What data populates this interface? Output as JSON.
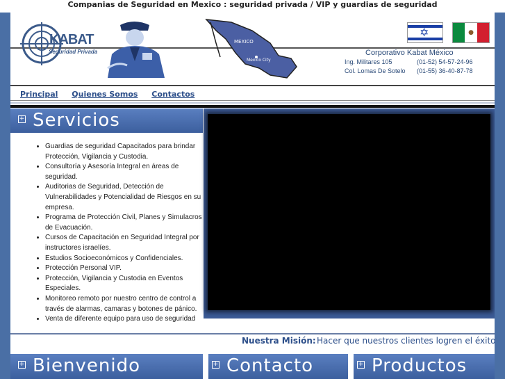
{
  "top_title": "Companias de Seguridad en Mexico : seguridad privada / VIP y guardias de seguridad",
  "logo": {
    "brand": "KABAT",
    "tagline": "Seguridad Privada"
  },
  "map": {
    "country_label": "MEXICO",
    "city_label": "Mexico City"
  },
  "corporate": {
    "name": "Corporativo Kabat México",
    "address1": "Ing. Militares 105",
    "phone1": "(01-52) 54-57-24-96",
    "address2": "Col. Lomas De Sotelo",
    "phone2": "(01-55) 36-40-87-78"
  },
  "nav": [
    "Principal",
    "Quienes Somos",
    "Contactos"
  ],
  "servicios": {
    "title": "Servicios",
    "items": [
      "Guardias  de seguridad Capacitados para brindar Protección, Vigilancia y Custodia.",
      "Consultoría y Asesoría Integral en áreas de seguridad.",
      "Auditorias de Seguridad, Detección de Vulnerabilidades y Potencialidad de Riesgos en su empresa.",
      "Programa de Protección Civil, Planes y Simulacros de Evacuación.",
      "Cursos de Capacitación en Seguridad Integral por instructores israelíes.",
      "Estudios Socioeconómicos y Confidenciales.",
      "Protección Personal VIP.",
      "Protección, Vigilancia y Custodia en Eventos Especiales.",
      "Monitoreo remoto por nuestro centro de control a través de alarmas, camaras y botones de pánico.",
      "Venta de diferente equipo para uso de seguridad"
    ]
  },
  "mision": {
    "label": "Nuestra Misión:",
    "text": "Hacer que nuestros clientes logren el éxito r"
  },
  "sections": [
    "Bienvenido",
    "Contacto",
    "Productos"
  ],
  "colors": {
    "page_bg": "#4a6fa5",
    "header_blue": "#3c5f9e",
    "link": "#2d4f8a"
  }
}
